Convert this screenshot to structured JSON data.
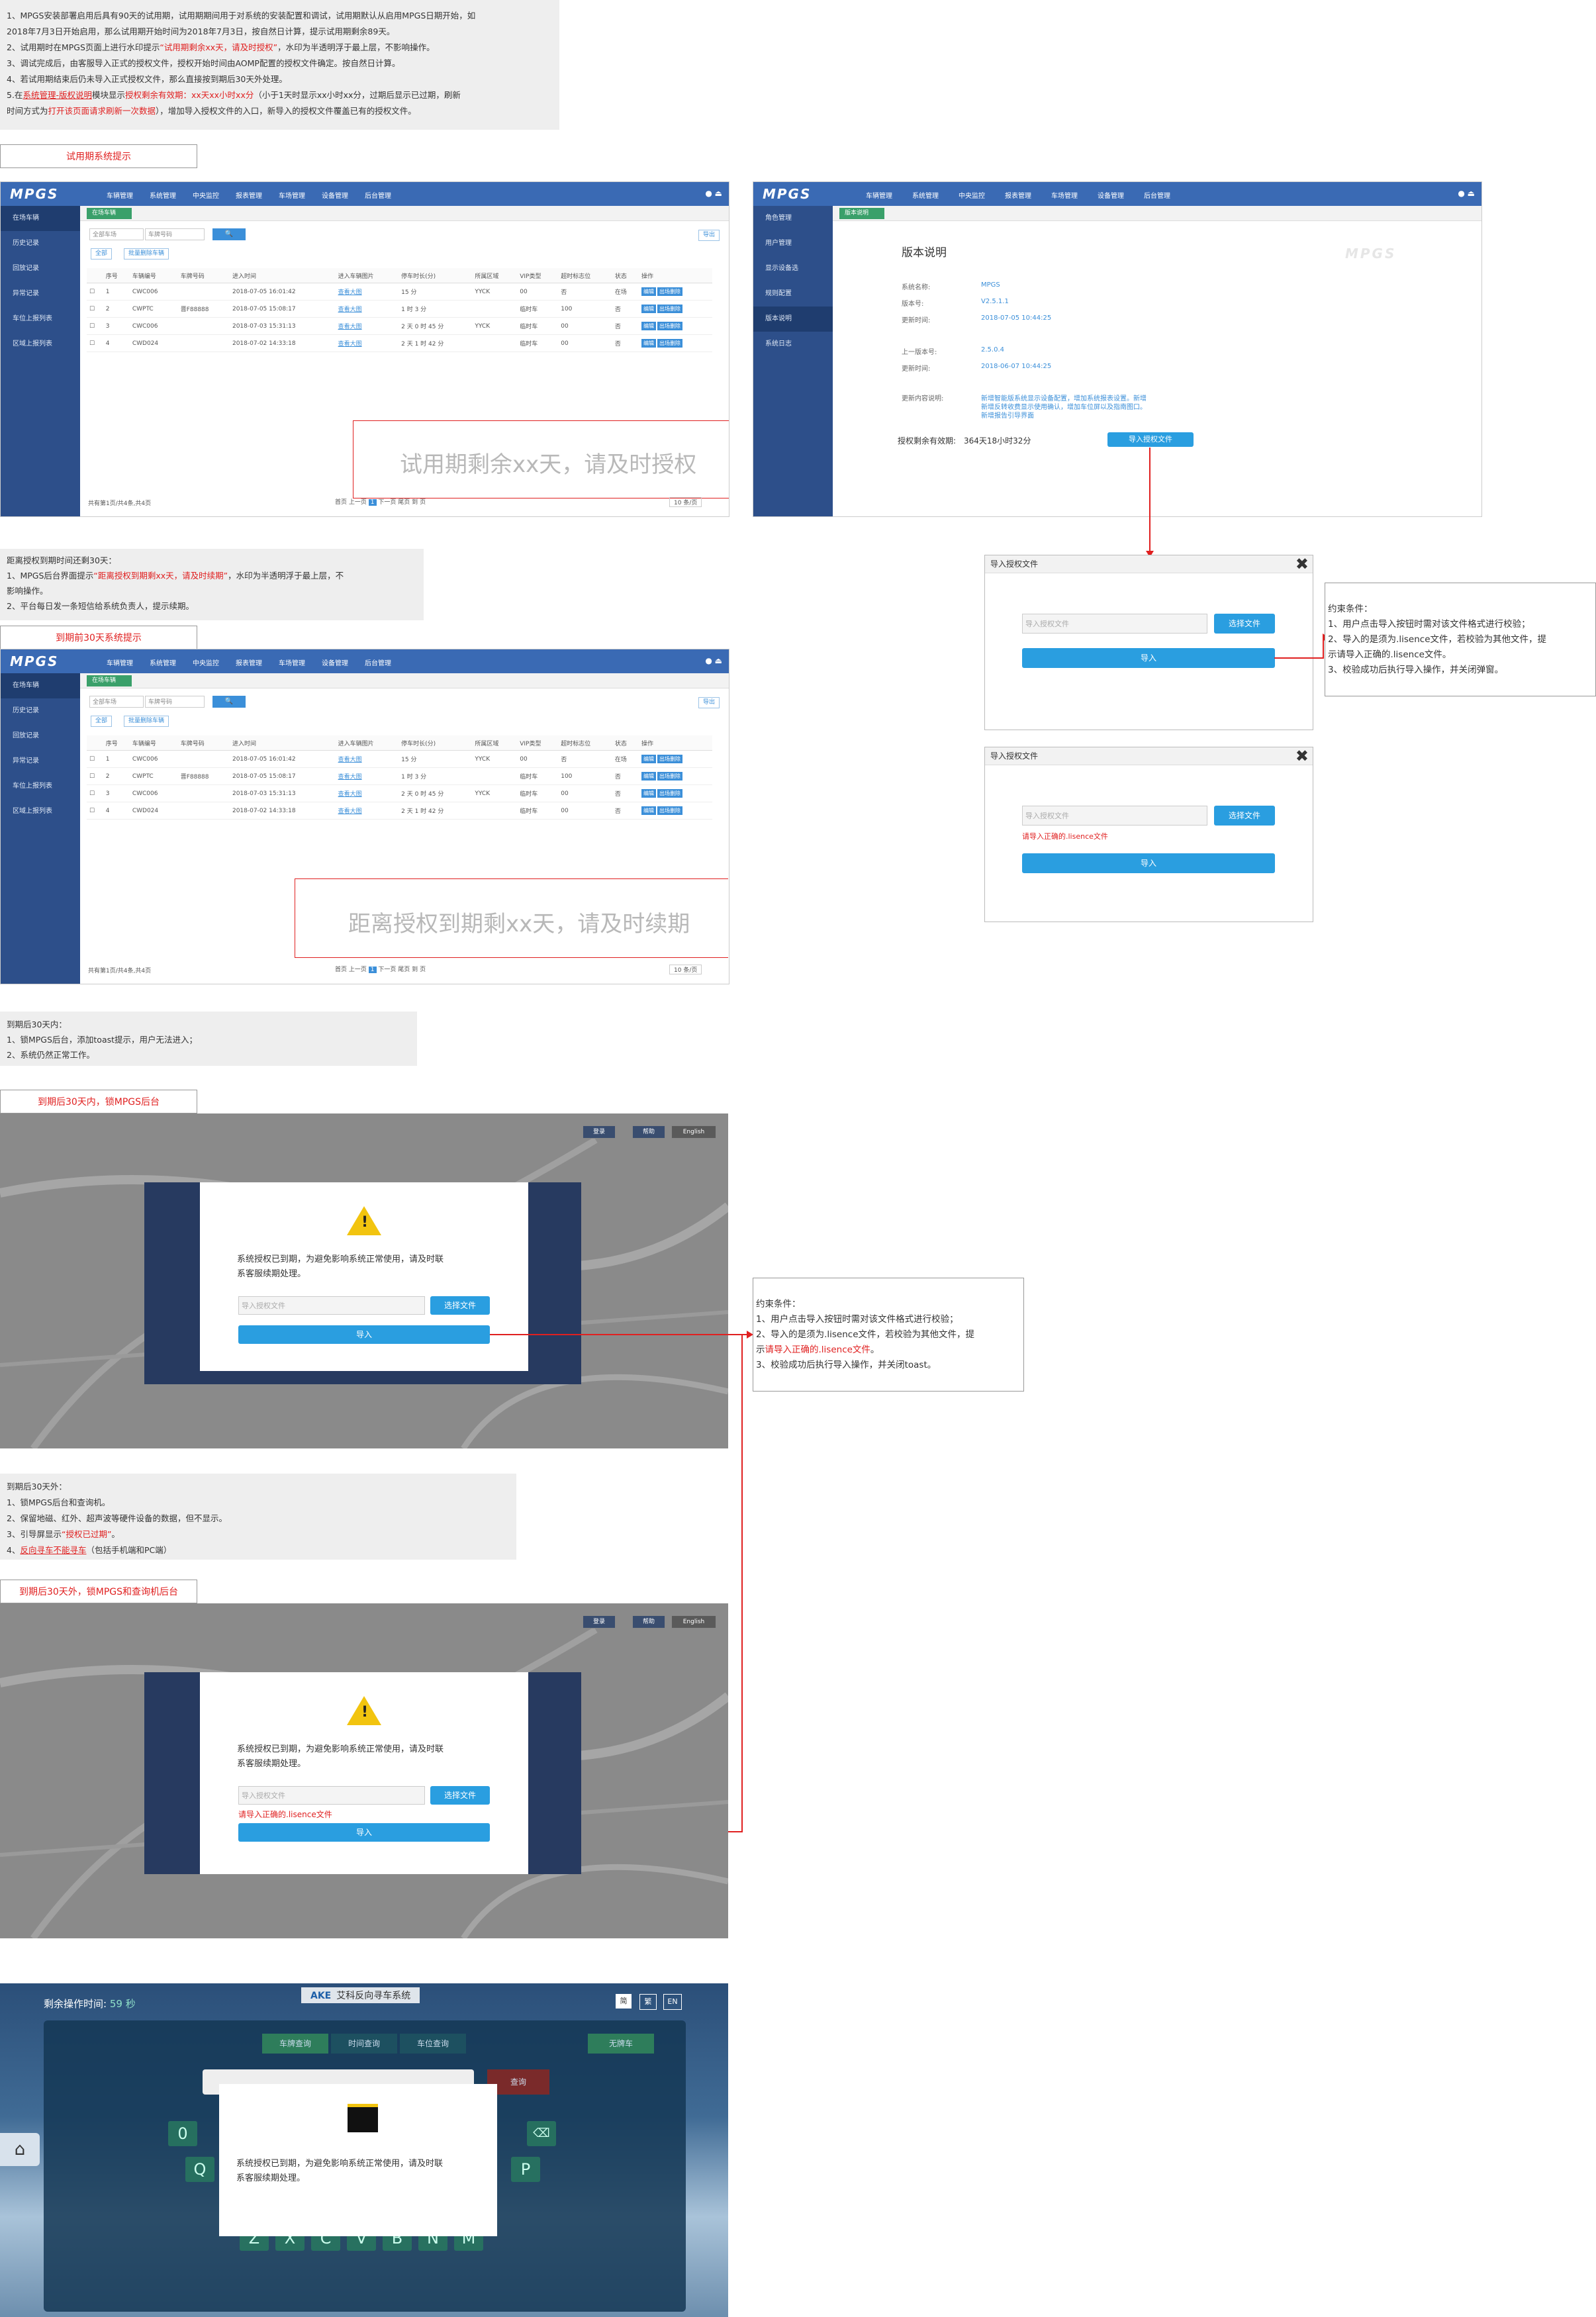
{
  "notes": {
    "n1": {
      "l1": "1、MPGS安装部署启用后具有90天的试用期，试用期期间用于对系统的安装配置和调试，试用期默认从启用MPGS日期开始，如",
      "l2": "2018年7月3日开始启用，那么试用期开始时间为2018年7月3日，按自然日计算，提示试用期剩余89天。",
      "l3a": "2、试用期时在MPGS页面上进行水印提示",
      "l3b": "“试用期剩余xx天，请及时授权”",
      "l3c": "，水印为半透明浮于最上层，不影响操作。",
      "l4": "3、调试完成后，由客服导入正式的授权文件，授权开始时间由AOMP配置的授权文件确定。按自然日计算。",
      "l5": "4、若试用期结束后仍未导入正式授权文件，那么直接按到期后30天外处理。",
      "l6a": "5.在",
      "l6b": "系统管理-版权说明",
      "l6c": "模块显示",
      "l6d": "授权剩余有效期：xx天xx小时xx分",
      "l6e": "（小于1天时显示xx小时xx分，过期后显示已过期，刷新",
      "l7a": "时间方式为",
      "l7b": "打开该页面请求刷新一次数据",
      "l7c": "），增加导入授权文件的入口，新导入的授权文件覆盖已有的授权文件。"
    },
    "n2": {
      "l1": "距离授权到期时间还剩30天：",
      "l2a": "1、MPGS后台界面提示",
      "l2b": "“距离授权到期剩xx天，请及时续期”",
      "l2c": "，水印为半透明浮于最上层，不",
      "l3": "影响操作。",
      "l4": "2、平台每日发一条短信给系统负责人，提示续期。"
    },
    "n3": {
      "l1": "到期后30天内：",
      "l2": "1、锁MPGS后台，添加toast提示，用户无法进入；",
      "l3": "2、系统仍然正常工作。"
    },
    "n4": {
      "l1": "到期后30天外：",
      "l2": "1、锁MPGS后台和查询机。",
      "l3": "2、保留地磁、红外、超声波等硬件设备的数据，但不显示。",
      "l4a": "3、引导屏显示",
      "l4b": "“授权已过期”",
      "l4c": "。",
      "l5a": "4、",
      "l5b": "反向寻车不能寻车",
      "l5c": "（包括手机端和PC端）"
    }
  },
  "tags": {
    "trial": "试用期系统提示",
    "before30": "到期前30天系统提示",
    "within30": "到期后30天内，锁MPGS后台",
    "after30": "到期后30天外，锁MPGS和查询机后台"
  },
  "admin": {
    "logo": "MPGS",
    "menu": [
      "车辆管理",
      "系统管理",
      "中央监控",
      "报表管理",
      "车场管理",
      "设备管理",
      "后台管理"
    ],
    "sidebar": [
      "在场车辆",
      "历史记录",
      "回放记录",
      "异常记录",
      "车位上报列表",
      "区域上报列表"
    ],
    "tab": "在场车辆",
    "filter_select": "全部车场",
    "plate_placeholder": "车牌号码",
    "export": "导出",
    "btn_all": "全部",
    "btn_batch": "批量删除车辆",
    "columns": [
      "序号",
      "车辆编号",
      "车牌号码",
      "进入时间",
      "进入车辆图片",
      "停车时长(分)",
      "所属区域",
      "VIP类型",
      "超时标志位",
      "状态",
      "计费状态",
      "操作"
    ],
    "rows": [
      [
        "1",
        "CWC006",
        "",
        "2018-07-05 16:01:42",
        "查看大图",
        "15 分",
        "YYCK",
        "00",
        "否",
        "在场"
      ],
      [
        "2",
        "CWPTC",
        "晋F88888",
        "2018-07-05 15:08:17",
        "查看大图",
        "1 时 3 分",
        "",
        "临时车",
        "100",
        "否"
      ],
      [
        "3",
        "CWC006",
        "",
        "2018-07-03 15:31:13",
        "查看大图",
        "2 天 0 时 45 分",
        "YYCK",
        "临时车",
        "00",
        "否"
      ],
      [
        "4",
        "CWD024",
        "",
        "2018-07-02 14:33:18",
        "查看大图",
        "2 天 1 时 42 分",
        "",
        "临时车",
        "00",
        "否"
      ]
    ],
    "op1": "编辑",
    "op2": "出场删除",
    "pager_left": "共有第1页/共4条,共4页",
    "pager_btns": [
      "首页",
      "上一页",
      "1",
      "下一页",
      "尾页",
      "到",
      "页"
    ],
    "pager_size": "10 条/页"
  },
  "watermarks": {
    "trial": "试用期剩余xx天，请及时授权",
    "before30": "距离授权到期剩xx天，请及时续期"
  },
  "version": {
    "sidebar": [
      "角色管理",
      "用户管理",
      "显示设备选",
      "规则配置",
      "版本说明",
      "系统日志"
    ],
    "tab": "版本说明",
    "title": "版本说明",
    "logo_mark": "MPGS",
    "sys_name_label": "系统名称:",
    "sys_name": "MPGS",
    "ver_label": "版本号:",
    "ver": "V2.5.1.1",
    "upd_label": "更新时间:",
    "upd": "2018-07-05 10:44:25",
    "prev_label": "上一版本号:",
    "prev": "2.5.0.4",
    "prev_upd_label": "更新时间:",
    "prev_upd": "2018-06-07 10:44:25",
    "content_label": "更新内容说明:",
    "content_1": "新增智能版系统显示设备配置，增加系统报表设置。新增",
    "content_2": "新增反转收费显示使用确认，增加车位屏以及指南图口。",
    "content_3": "新增报告引导界面",
    "license_label": "授权剩余有效期:",
    "license_value": "364天18小时32分",
    "import_btn": "导入授权文件"
  },
  "import_dialog": {
    "title": "导入授权文件",
    "placeholder": "导入授权文件",
    "choose": "选择文件",
    "submit": "导入",
    "error": "请导入正确的.lisence文件"
  },
  "cond1": {
    "l1": "约束条件：",
    "l2": "1、用户点击导入按钮时需对该文件格式进行校验；",
    "l3": "2、导入的是须为.lisence文件，若校验为其他文件，提",
    "l4": "示请导入正确的.lisence文件。",
    "l5": "3、校验成功后执行导入操作，并关闭弹窗。"
  },
  "cond2": {
    "l1": "约束条件：",
    "l2": "1、用户点击导入按钮时需对该文件格式进行校验；",
    "l3": "2、导入的是须为.lisence文件，若校验为其他文件，提",
    "l4a": "示",
    "l4b": "请导入正确的.lisence文件",
    "l4c": "。",
    "l5": "3、校验成功后执行导入操作，并关闭toast。"
  },
  "lock": {
    "top_btns": [
      "登录",
      "帮助",
      "English"
    ],
    "message_1": "系统授权已到期，为避免影响系统正常使用，请及时联",
    "message_2": "系客服续期处理。",
    "placeholder": "导入授权文件",
    "choose": "选择文件",
    "submit": "导入",
    "error": "请导入正确的.lisence文件"
  },
  "kiosk": {
    "timer_label": "剩余操作时间:",
    "timer_value": "59 秒",
    "brand": "AKE",
    "brand_name": "艾科反向寻车系统",
    "lang": [
      "简",
      "繁",
      "EN"
    ],
    "tabs": [
      "车牌查询",
      "时间查询",
      "车位查询"
    ],
    "no_plate": "无牌车",
    "query": "查询",
    "keys_top": [
      "0"
    ],
    "keys_q": [
      "Q",
      "P"
    ],
    "keys_bottom": [
      "Z",
      "X",
      "C",
      "V",
      "B",
      "N",
      "M"
    ],
    "message_1": "系统授权已到期，为避免影响系统正常使用，请及时联",
    "message_2": "系客服续期处理。"
  },
  "colors": {
    "accent": "#3a6ab4",
    "sidebar": "#2d4f8a",
    "alert": "#e02020",
    "button": "#2a9ee0"
  }
}
